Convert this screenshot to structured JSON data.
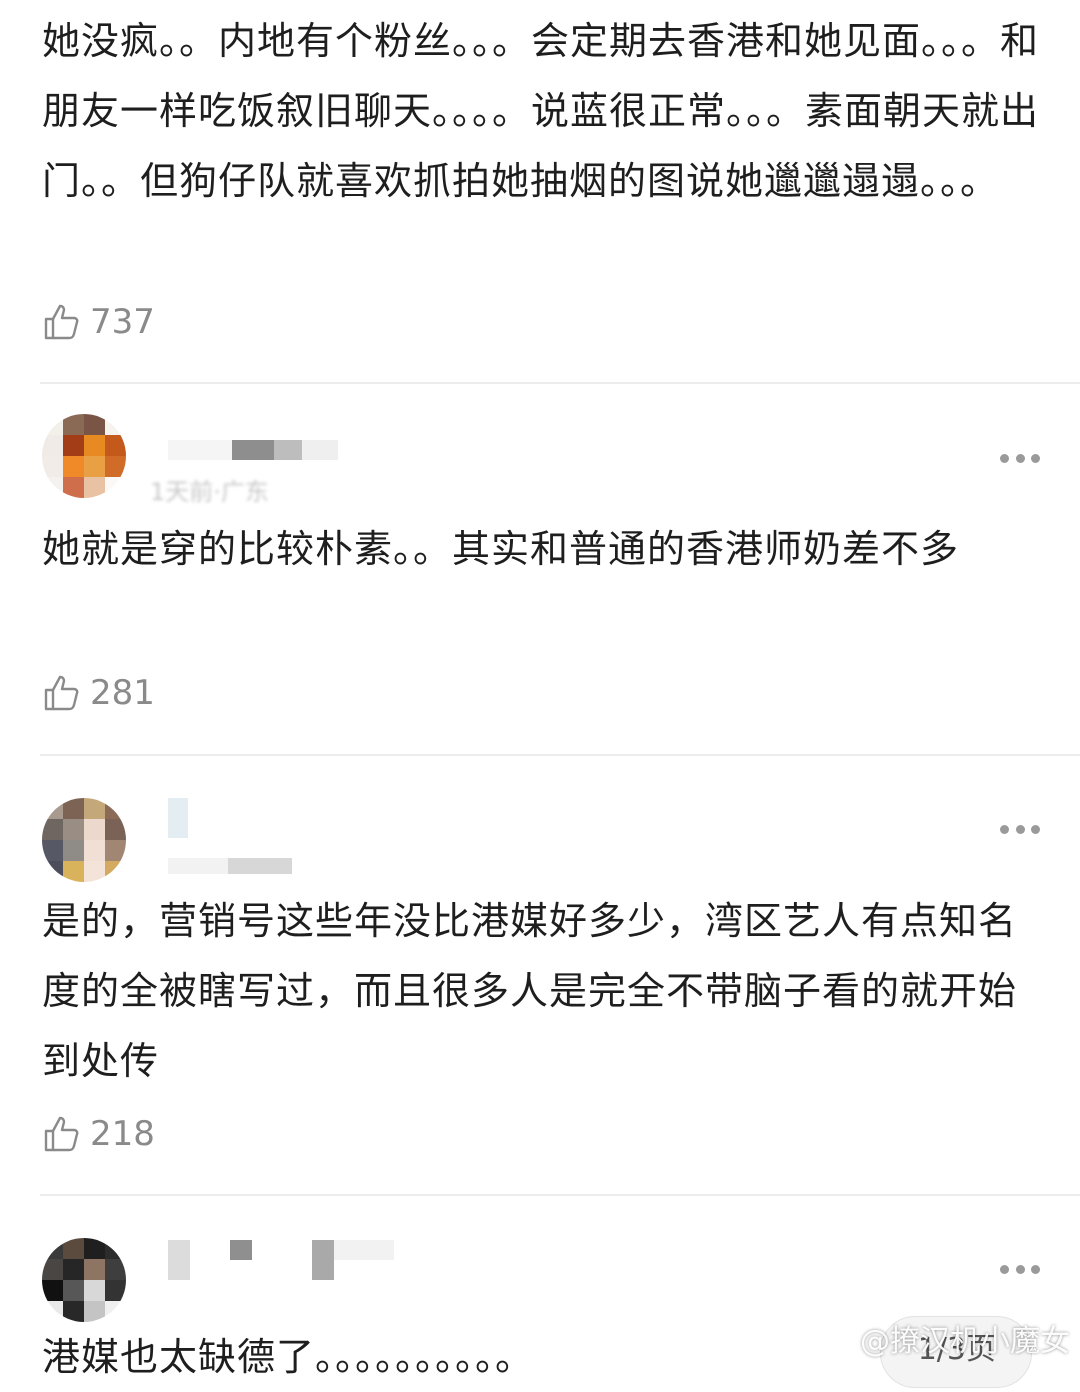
{
  "comments": [
    {
      "text": "她没疯。。内地有个粉丝。。。会定期去香港和她见面。。。和朋友一样吃饭叙旧聊天。。。。说蓝很正常。。。素面朝天就出门。。但狗仔队就喜欢抓拍她抽烟的图说她邋邋遢遢。。。",
      "likes": "737"
    },
    {
      "time": "1天前·广东",
      "text": "她就是穿的比较朴素。。其实和普通的香港师奶差不多",
      "likes": "281"
    },
    {
      "text": "是的，营销号这些年没比港媒好多少，湾区艺人有点知名度的全被瞎写过，而且很多人是完全不带脑子看的就开始到处传",
      "likes": "218"
    },
    {
      "text": "港媒也太缺德了。。。。。。。。。。"
    }
  ],
  "watermark": "@撩汉机小魔女",
  "page_indicator": "1/3页",
  "colors": {
    "text": "#1e1e1e",
    "muted": "#8a8a8a",
    "divider": "#ececec"
  }
}
